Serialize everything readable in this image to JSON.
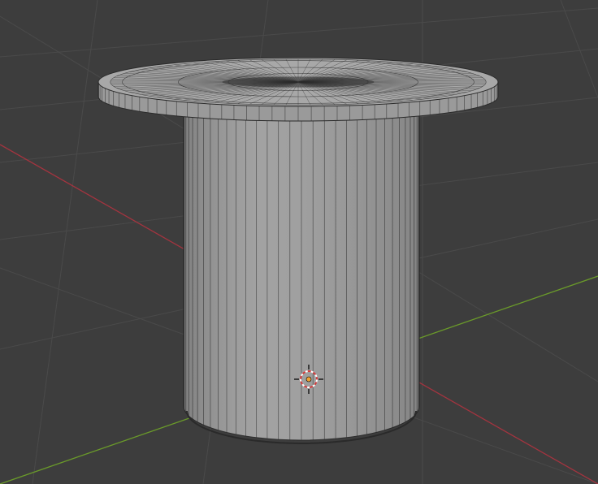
{
  "viewport": {
    "mode": "edit-mode-wireframe-overlay",
    "background_color": "#3d3d3d",
    "grid_color": "#4a4a4a",
    "x_axis_color": "#a3343f",
    "y_axis_color": "#6a9a2a"
  },
  "object": {
    "name": "cylinder-with-flange",
    "shape": "cylinder",
    "body_color": "#9c9c9c",
    "flange_color": "#a8a8a8",
    "edge_color": "#2a2a2a",
    "vertical_segments": 64
  },
  "cursor_3d": {
    "icon": "3d-cursor-icon",
    "ring_colors": [
      "#d23c3c",
      "#ffffff"
    ]
  },
  "origin": {
    "icon": "object-origin-icon",
    "color": "#f0a030"
  }
}
